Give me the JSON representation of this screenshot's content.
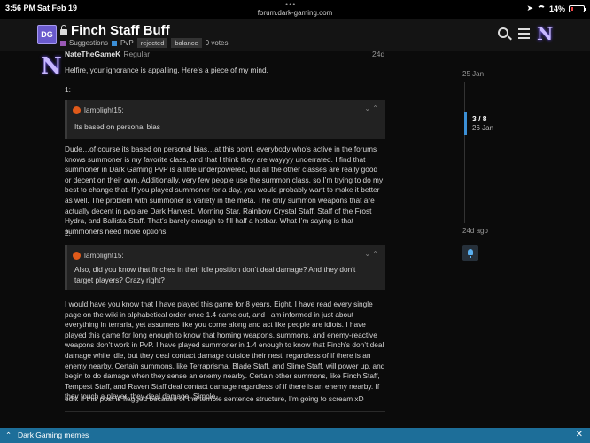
{
  "status_bar": {
    "time": "3:56 PM",
    "date": "Sat Feb 19",
    "url": "forum.dark-gaming.com",
    "battery": "14%"
  },
  "header": {
    "logo_text": "DG",
    "title": "Finch Staff Buff",
    "category": "Suggestions",
    "subcategory": "PvP",
    "tags": [
      "rejected",
      "balance"
    ],
    "votes": "0 votes",
    "category_color": "#9b59b6",
    "subcategory_color": "#3b8fd6"
  },
  "post": {
    "username": "NateTheGameK",
    "role": "Regular",
    "age": "24d",
    "intro": "Helfire, your ignorance is appalling. Here’s a piece of my mind.",
    "label1": "1:",
    "quote1": {
      "author": "lamplight15:",
      "text": "Its based on personal bias"
    },
    "para1": "Dude…of course its based on personal bias…at this point, everybody who’s active in the forums knows summoner is my favorite class, and that I think they are wayyyy underrated. I find that summoner in Dark Gaming PvP is a little underpowered, but all the other classes are really good or decent on their own. Additionally, very few people use the summon class, so I’m trying to do my best to change that. If you played summoner for a day, you would probably want to make it better as well. The problem with summoner is variety in the meta. The only summon weapons that are actually decent in pvp are Dark Harvest, Morning Star, Rainbow Crystal Staff, Staff of the Frost Hydra, and Ballista Staff. That’s barely enough to fill half a hotbar. What I’m saying is that summoners need more options.",
    "label2": "2:",
    "quote2": {
      "author": "lamplight15:",
      "text": "Also, did you know that finches in their idle position don’t deal damage? And they don’t target players? Crazy right?"
    },
    "para2": "I would have you know that I have played this game for 8 years. Eight. I have read every single page on the wiki in alphabetical order once 1.4 came out, and I am informed in just about everything in terraria, yet assumers like you come along and act like people are idiots. I have played this game for long enough to know that homing weapons, summons, and enemy-reactive weapons don’t work in PvP. I have played summoner in 1.4 enough to know that Finch’s don’t deal damage while idle, but they deal contact damage outside their nest, regardless of if there is an enemy nearby. Certain summons, like Terraprisma, Blade Staff, and Slime Staff, will power up, and begin to do damage when they sense an enemy nearby. Certain other summons, like Finch Staff, Tempest Staff, and Raven Staff deal contact damage regardless of if there is an enemy nearby. If they touch a player, they deal damage. Simple.",
    "edit": "edit: if this post is flagged because of the terrible sentence structure, I’m going to scream xD"
  },
  "timeline": {
    "start": "25 Jan",
    "position": "3 / 8",
    "position_date": "26 Jan",
    "end": "24d ago"
  },
  "bottom_bar": {
    "label": "Dark Gaming memes"
  }
}
